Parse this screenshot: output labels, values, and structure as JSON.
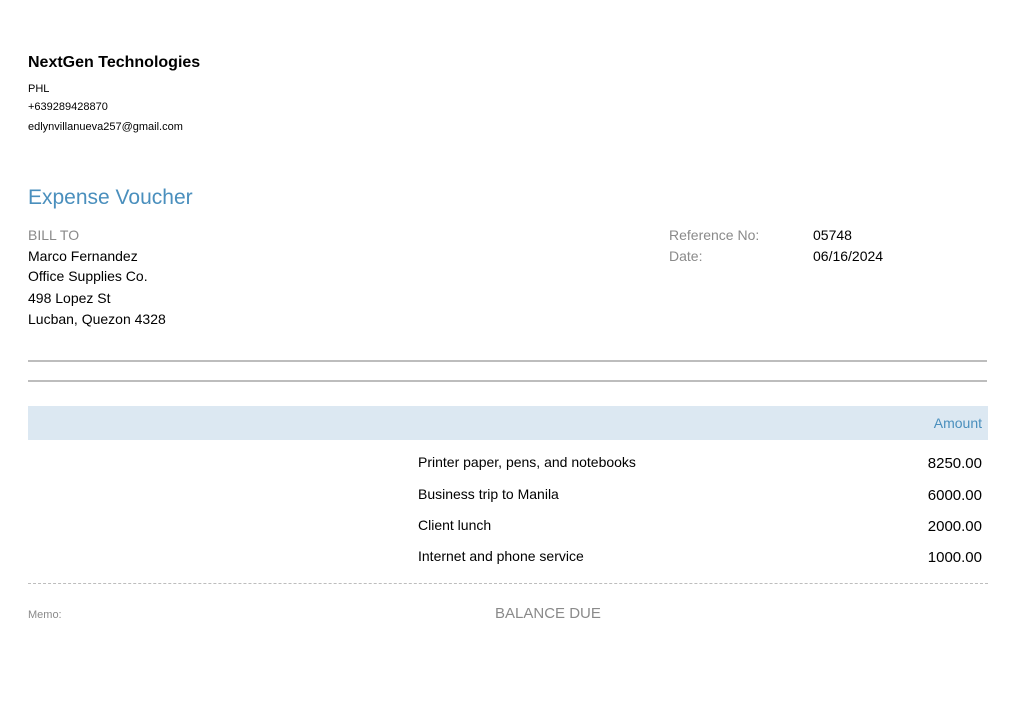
{
  "company": {
    "name": "NextGen Technologies",
    "country": "PHL",
    "phone": "+639289428870",
    "email": "edlynvillanueva257@gmail.com"
  },
  "document": {
    "title": "Expense Voucher"
  },
  "bill_to": {
    "label": "BILL TO",
    "lines": [
      "Marco Fernandez",
      "Office Supplies Co.",
      "498 Lopez St",
      "Lucban, Quezon  4328"
    ]
  },
  "meta": {
    "reference_label": "Reference No:",
    "reference_value": "05748",
    "date_label": "Date:",
    "date_value": "06/16/2024"
  },
  "table": {
    "amount_header": "Amount",
    "rows": [
      {
        "description": "Printer paper, pens, and notebooks",
        "amount": "8250.00"
      },
      {
        "description": "Business trip to Manila",
        "amount": "6000.00"
      },
      {
        "description": "Client lunch",
        "amount": "2000.00"
      },
      {
        "description": "Internet and phone service",
        "amount": "1000.00"
      }
    ]
  },
  "footer": {
    "memo_label": "Memo:",
    "balance_label": "BALANCE DUE"
  }
}
